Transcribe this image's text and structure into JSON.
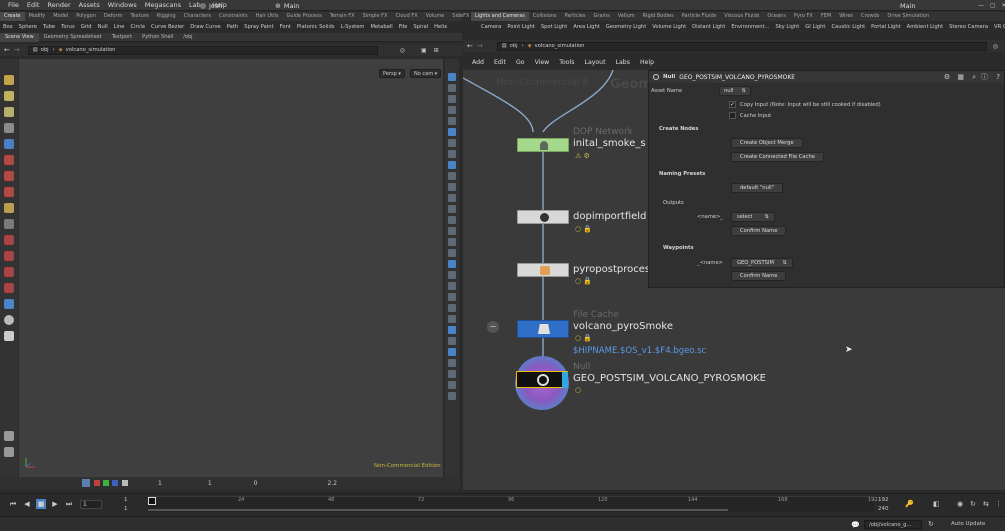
{
  "menubar": {
    "items": [
      "File",
      "Edit",
      "Render",
      "Assets",
      "Windows",
      "Megascans",
      "Labs",
      "Help"
    ],
    "user": "Josh",
    "desktop": "Main",
    "desktop_right": "Main"
  },
  "shelf_left": {
    "tabs": [
      "Create",
      "Modify",
      "Model",
      "Polygon",
      "Deform",
      "Texture",
      "Rigging",
      "Characters",
      "Constraints",
      "Hair Utils",
      "Guide Process",
      "Terrain FX",
      "Simple FX",
      "Cloud FX",
      "Volume",
      "SideFX Labs"
    ],
    "tools": [
      "Box",
      "Sphere",
      "Tube",
      "Torus",
      "Grid",
      "Null",
      "Line",
      "Circle",
      "Curve Bezier",
      "Draw Curve",
      "Path",
      "Spray Paint",
      "Font",
      "Platonic Solids",
      "L-System",
      "Metaball",
      "File",
      "Spiral",
      "Helix"
    ]
  },
  "shelf_right": {
    "tabs": [
      "Lights and Cameras",
      "Collisions",
      "Particles",
      "Grains",
      "Vellum",
      "Rigid Bodies",
      "Particle Fluids",
      "Viscous Fluids",
      "Oceans",
      "Pyro FX",
      "FEM",
      "Wires",
      "Crowds",
      "Drive Simulation"
    ],
    "tools": [
      "Camera",
      "Point Light",
      "Spot Light",
      "Area Light",
      "Geometry Light",
      "Volume Light",
      "Distant Light",
      "Environment...",
      "Sky Light",
      "GI Light",
      "Caustic Light",
      "Portal Light",
      "Ambient Light",
      "Stereo Camera",
      "VR Ca"
    ]
  },
  "left_pane": {
    "tabs": [
      "Scene View",
      "Geometry Spreadsheet",
      "Textport",
      "Python Shell",
      "/obj"
    ],
    "path_root": "obj",
    "path_node": "volcano_simulation",
    "view_btn": "Persp",
    "cam_btn": "No cam",
    "watermark": "Non-Commercial Edition"
  },
  "right_pane": {
    "path_root": "obj",
    "path_node": "volcano_simulation",
    "menu": [
      "Add",
      "Edit",
      "Go",
      "View",
      "Tools",
      "Layout",
      "Labs",
      "Help"
    ],
    "bg_watermark": "Non-Commercial E",
    "bg_context": "Geometry"
  },
  "nodes": {
    "n1": {
      "type": "DOP Network",
      "name": "inital_smoke_s"
    },
    "n2": {
      "name": "dopimportfield"
    },
    "n3": {
      "name": "pyropostproces"
    },
    "n4": {
      "type": "File Cache",
      "name": "volcano_pyroSmoke",
      "path": "$HIPNAME.$OS_v1.$F4.bgeo.sc"
    },
    "n5": {
      "type": "Null",
      "name": "GEO_POSTSIM_VOLCANO_PYROSMOKE"
    }
  },
  "params": {
    "node_type": "Null",
    "node_name": "GEO_POSTSIM_VOLCANO_PYROSMOKE",
    "asset_name_label": "Asset Name",
    "asset_name_value": "null",
    "copy_input": "Copy Input (Note: Input will be still cooked if disabled)",
    "cache_input": "Cache Input",
    "create_nodes": "Create Nodes",
    "btn_object_merge": "Create Object Merge",
    "btn_file_cache": "Create Connected File Cache",
    "naming_presets": "Naming Presets",
    "btn_default_null": "default \"null\"",
    "outputs": "Outputs",
    "outputs_name": "<name>_",
    "outputs_select": "select",
    "btn_confirm1": "Confirm Name",
    "waypoints": "Waypoints",
    "waypoints_name": "_<name>",
    "waypoints_value": "GEO_POSTSIM",
    "btn_confirm2": "Confirm Name"
  },
  "vp_bottom": {
    "f1": "1",
    "f2": "1",
    "f3": "0",
    "f4": "2.2"
  },
  "timeline": {
    "frame": "1",
    "start": "1",
    "start2": "1",
    "ticks": [
      "1",
      "24",
      "48",
      "72",
      "96",
      "120",
      "144",
      "168",
      "192"
    ],
    "end": "192",
    "end2": "240"
  },
  "status": {
    "path": "/obj/volcano_g...",
    "auto_update": "Auto Update"
  }
}
